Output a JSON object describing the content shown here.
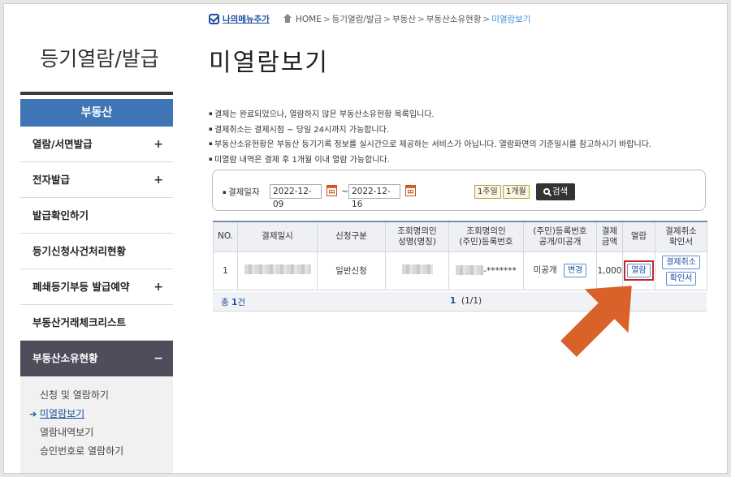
{
  "sidebar": {
    "title": "등기열람/발급",
    "section_head": "부동산",
    "items": [
      {
        "label": "열람/서면발급",
        "expand": "+"
      },
      {
        "label": "전자발급",
        "expand": "+"
      },
      {
        "label": "발급확인하기",
        "expand": ""
      },
      {
        "label": "등기신청사건처리현황",
        "expand": ""
      },
      {
        "label": "폐쇄등기부등 발급예약",
        "expand": "+"
      },
      {
        "label": "부동산거래체크리스트",
        "expand": ""
      },
      {
        "label": "부동산소유현황",
        "expand": "−"
      }
    ],
    "sub_items": [
      {
        "label": "신청 및 열람하기"
      },
      {
        "label": "미열람보기",
        "marker": "➔"
      },
      {
        "label": "열람내역보기"
      },
      {
        "label": "승인번호로 열람하기"
      }
    ]
  },
  "breadcrumb": {
    "my_menu": "나의메뉴추가",
    "home": "HOME",
    "sep": ">",
    "path": [
      "등기열람/발급",
      "부동산",
      "부동산소유현황"
    ],
    "current": "미열람보기"
  },
  "page_title": "미열람보기",
  "notes": [
    "결제는 완료되었으나, 열람하지 않은 부동산소유현황 목록입니다.",
    "결제취소는 결제시점 ~ 당일 24시까지 가능합니다.",
    "부동산소유현황은 부동산 등기기록 정보를 실시간으로 제공하는 서비스가 아닙니다. 열람화면의 기준일시를 참고하시기 바랍니다.",
    "미열람 내역은 결제 후 1개월 이내 열람 가능합니다."
  ],
  "search": {
    "label": "결제일자",
    "date_from": "2022-12-09",
    "tilde": "~",
    "date_to": "2022-12-16",
    "week_btn": "1주일",
    "month_btn": "1개월",
    "search_btn": "검색"
  },
  "table": {
    "headers": [
      [
        "NO."
      ],
      [
        "결제일시"
      ],
      [
        "신청구분"
      ],
      [
        "조회명의인",
        "성명(명칭)"
      ],
      [
        "조회명의인",
        "(주민)등록번호"
      ],
      [
        "(주민)등록번호",
        "공개/미공개"
      ],
      [
        "결제",
        "금액"
      ],
      [
        "열람"
      ],
      [
        "결제취소",
        "확인서"
      ]
    ],
    "rows": [
      {
        "no": "1",
        "type": "일반신청",
        "reg_suffix": "-*******",
        "disclosure": "미공개",
        "change_btn": "변경",
        "amount": "1,000",
        "view_btn": "열람",
        "cancel_btn": "결제취소",
        "receipt_btn": "확인서"
      }
    ],
    "total_label": "총",
    "total_count": "1",
    "total_unit": "건",
    "page_current": "1",
    "page_info": "(1/1)"
  },
  "colors": {
    "accent_blue": "#3f75b5",
    "sidebar_active": "#4d4d5c",
    "highlight_arrow": "#d9622b",
    "highlight_box": "#c8252b"
  }
}
